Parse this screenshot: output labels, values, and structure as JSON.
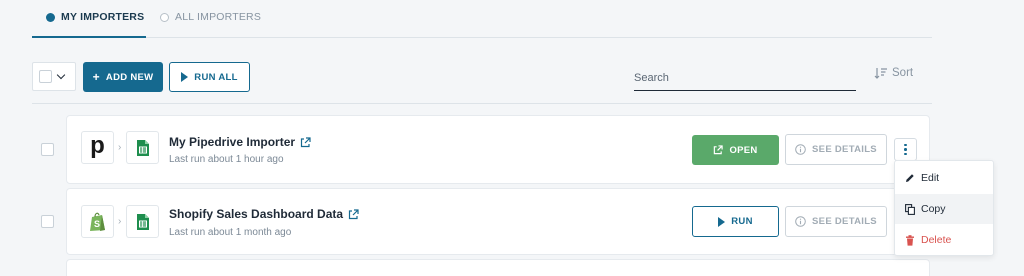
{
  "tabs": [
    {
      "label": "MY IMPORTERS",
      "active": true
    },
    {
      "label": "ALL IMPORTERS",
      "active": false
    }
  ],
  "toolbar": {
    "add_label": "ADD NEW",
    "runall_label": "RUN ALL",
    "search_placeholder": "Search",
    "sort_label": "Sort"
  },
  "importers": [
    {
      "name": "My Pipedrive Importer",
      "last_run": "Last run about 1 hour ago",
      "source_icon": "pipedrive-logo-icon",
      "dest_icon": "google-sheets-icon",
      "primary_label": "OPEN",
      "details_label": "SEE DETAILS"
    },
    {
      "name": "Shopify Sales Dashboard Data",
      "last_run": "Last run about 1 month ago",
      "source_icon": "shopify-logo-icon",
      "dest_icon": "google-sheets-icon",
      "primary_label": "RUN",
      "details_label": "SEE DETAILS"
    }
  ],
  "row_menu": {
    "items": [
      {
        "label": "Edit",
        "icon": "pencil-icon"
      },
      {
        "label": "Copy",
        "icon": "copy-icon"
      },
      {
        "label": "Delete",
        "icon": "trash-icon"
      }
    ]
  },
  "colors": {
    "accent": "#15698f",
    "open_button": "#5aa96a",
    "danger": "#d9534f",
    "sheets_green": "#1e8e4e"
  },
  "logo_letter": "p"
}
